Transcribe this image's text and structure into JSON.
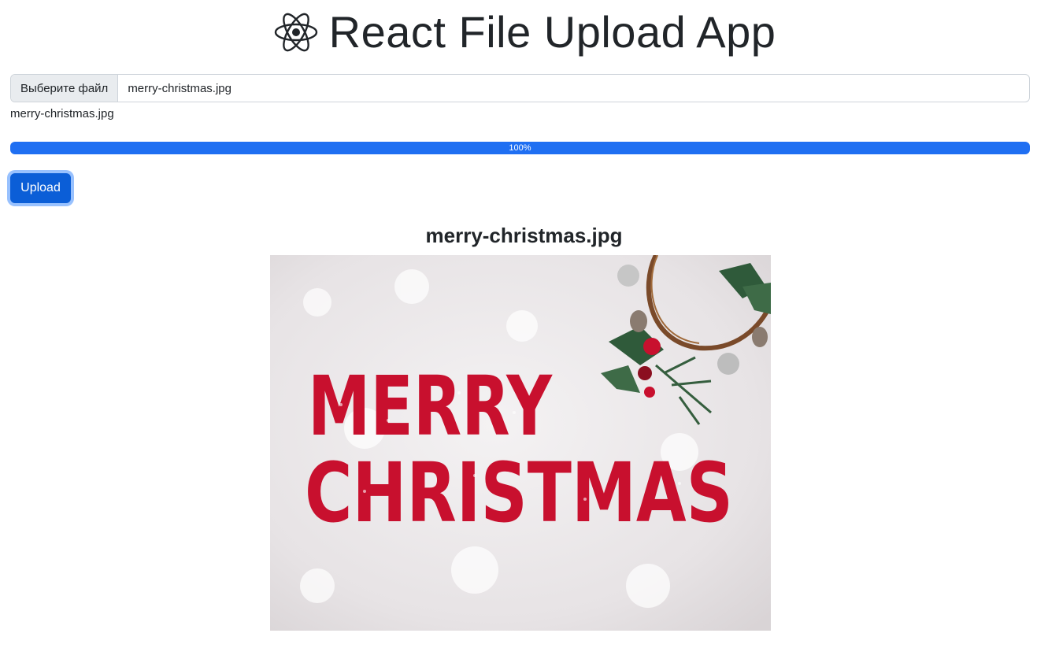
{
  "header": {
    "title": "React File Upload App",
    "logo_icon": "react-logo-icon"
  },
  "file_input": {
    "choose_label": "Выберите файл",
    "selected_file": "merry-christmas.jpg"
  },
  "selected_file_label": "merry-christmas.jpg",
  "progress": {
    "value": 100,
    "label": "100%",
    "color": "#1f6ff2"
  },
  "upload_button": {
    "label": "Upload",
    "color": "#0b5ed7"
  },
  "preview": {
    "title": "merry-christmas.jpg",
    "image_text_line1": "MERRY",
    "image_text_line2": "CHRISTMAS"
  }
}
